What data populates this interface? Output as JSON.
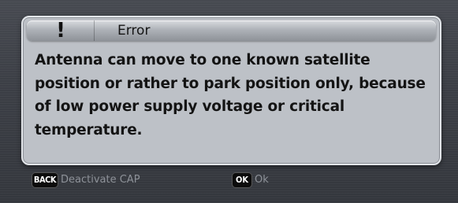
{
  "dialog": {
    "icon": "exclamation-icon",
    "icon_glyph": "!",
    "title": "Error",
    "message": "Antenna can move to one known satellite position or rather to park position only, because of low power supply voltage or critical temperature."
  },
  "footer": {
    "back_key": "BACK",
    "back_label": "Deactivate CAP",
    "ok_key": "OK",
    "ok_label": "Ok"
  },
  "colors": {
    "dialog_background": "#bdc1c7",
    "screen_background": "#3c3f46",
    "text": "#141414",
    "footer_text": "#8e9299"
  }
}
